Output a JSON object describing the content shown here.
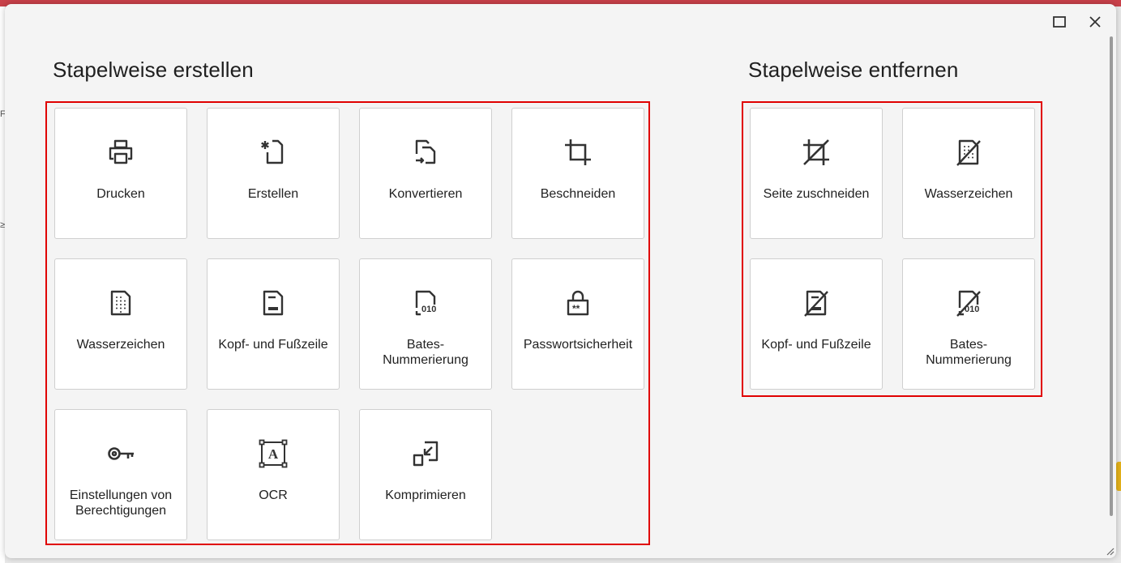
{
  "colors": {
    "accent_red": "#e00000",
    "topbar": "#c9414a",
    "card_bg": "#ffffff",
    "dialog_bg": "#f4f4f4"
  },
  "window_controls": {
    "maximize_icon": "maximize-icon",
    "close_icon": "close-icon"
  },
  "background_glyphs": [
    "F",
    "≥"
  ],
  "create_section": {
    "title": "Stapelweise erstellen",
    "cards": [
      {
        "label": "Drucken",
        "icon": "printer-icon"
      },
      {
        "label": "Erstellen",
        "icon": "new-document-icon"
      },
      {
        "label": "Konvertieren",
        "icon": "convert-icon"
      },
      {
        "label": "Beschneiden",
        "icon": "crop-icon"
      },
      {
        "label": "Wasserzeichen",
        "icon": "watermark-icon"
      },
      {
        "label": "Kopf- und Fußzeile",
        "icon": "header-footer-icon"
      },
      {
        "label": "Bates-\nNummerierung",
        "icon": "bates-numbering-icon"
      },
      {
        "label": "Passwortsicherheit",
        "icon": "lock-icon"
      },
      {
        "label": "Einstellungen von\nBerechtigungen",
        "icon": "key-icon"
      },
      {
        "label": "OCR",
        "icon": "ocr-icon"
      },
      {
        "label": "Komprimieren",
        "icon": "compress-icon"
      }
    ]
  },
  "remove_section": {
    "title": "Stapelweise entfernen",
    "cards": [
      {
        "label": "Seite zuschneiden",
        "icon": "remove-crop-icon"
      },
      {
        "label": "Wasserzeichen",
        "icon": "remove-watermark-icon"
      },
      {
        "label": "Kopf- und Fußzeile",
        "icon": "remove-header-footer-icon"
      },
      {
        "label": "Bates-\nNummerierung",
        "icon": "remove-bates-icon"
      }
    ]
  }
}
